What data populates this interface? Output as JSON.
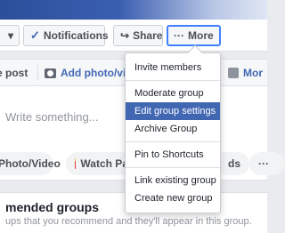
{
  "header": {
    "joined_chevron": "▾",
    "notifications_icon": "✓",
    "notifications_label": "Notifications",
    "share_icon": "↪",
    "share_label": "Share",
    "more_dots": "···",
    "more_label": "More"
  },
  "composer": {
    "tabs": {
      "post": "e post",
      "photo_video": "Add photo/vide",
      "more": "Mor"
    },
    "placeholder": "Write something...",
    "chips": {
      "photo_video": "Photo/Video",
      "watch_party": "Watch Pa",
      "third": "ds",
      "dots": "···"
    }
  },
  "recommended": {
    "title": "mended groups",
    "subtitle": "ups that you recommend and they'll appear in this group."
  },
  "menu": {
    "items": [
      {
        "label": "Invite members"
      },
      {
        "label": "Moderate group"
      },
      {
        "label": "Edit group settings",
        "active": true
      },
      {
        "label": "Archive Group"
      },
      {
        "label": "Pin to Shortcuts"
      },
      {
        "label": "Link existing group"
      },
      {
        "label": "Create new group"
      }
    ]
  },
  "colors": {
    "accent": "#4267b2",
    "focus_border": "#4080ff"
  }
}
